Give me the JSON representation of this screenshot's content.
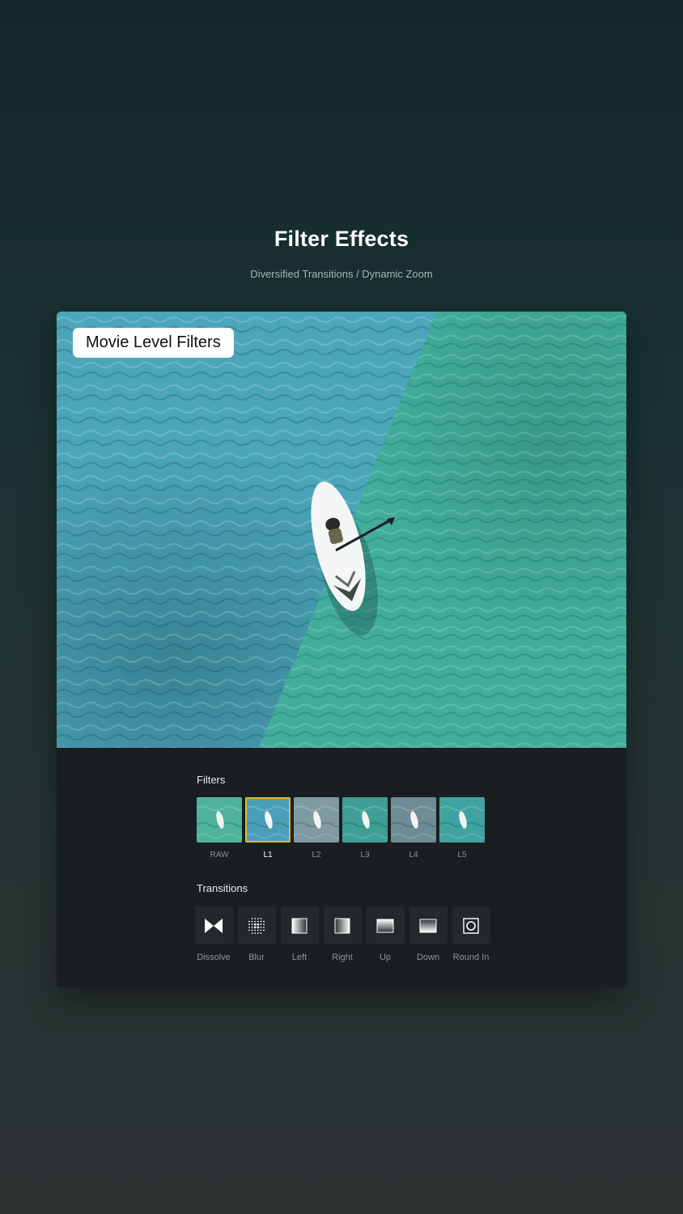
{
  "header": {
    "title": "Filter Effects",
    "subtitle": "Diversified Transitions / Dynamic Zoom"
  },
  "preview": {
    "badge": "Movie Level Filters"
  },
  "filters": {
    "label": "Filters",
    "selected": "L1",
    "items": [
      {
        "name": "RAW",
        "tint": "#4fb39c"
      },
      {
        "name": "L1",
        "tint": "#4a9fb8"
      },
      {
        "name": "L2",
        "tint": "#7f9aa0"
      },
      {
        "name": "L3",
        "tint": "#3f9e95"
      },
      {
        "name": "L4",
        "tint": "#6f8b95"
      },
      {
        "name": "L5",
        "tint": "#3fa3a0"
      }
    ]
  },
  "transitions": {
    "label": "Transitions",
    "items": [
      {
        "name": "Dissolve",
        "icon": "dissolve-icon"
      },
      {
        "name": "Blur",
        "icon": "blur-icon"
      },
      {
        "name": "Left",
        "icon": "wipe-left-icon"
      },
      {
        "name": "Right",
        "icon": "wipe-right-icon"
      },
      {
        "name": "Up",
        "icon": "wipe-up-icon"
      },
      {
        "name": "Down",
        "icon": "wipe-down-icon"
      },
      {
        "name": "Round In",
        "icon": "round-in-icon"
      }
    ]
  },
  "colors": {
    "selected_outline": "#e3b823",
    "card_bg": "#1a1e20"
  }
}
